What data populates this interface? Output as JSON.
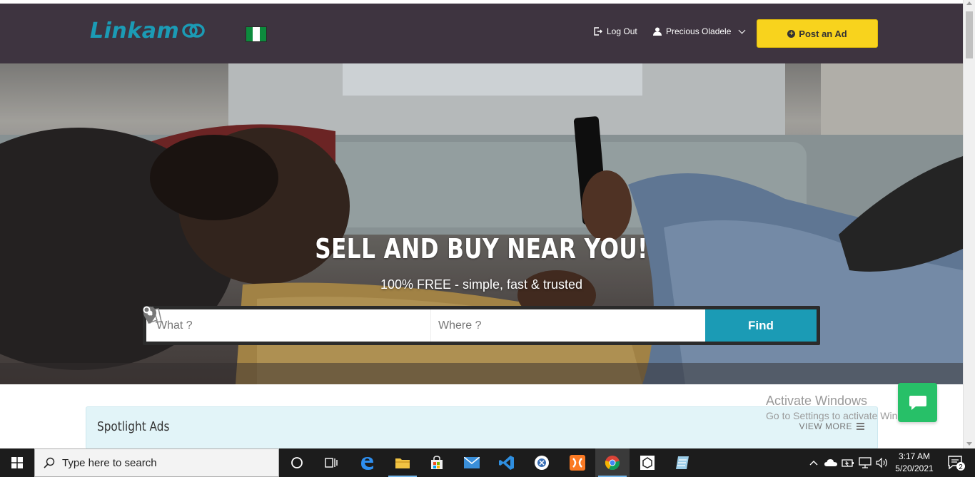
{
  "header": {
    "logo_text": "Linkam",
    "logout_label": "Log Out",
    "user_name": "Precious Oladele",
    "post_ad_label": "Post an Ad",
    "brand_color": "#1b9bb5",
    "accent_color": "#f8d31d"
  },
  "hero": {
    "title": "SELL AND BUY NEAR YOU!",
    "subtitle": "100% FREE - simple, fast & trusted",
    "search": {
      "what_placeholder": "What ?",
      "where_placeholder": "Where ?",
      "find_label": "Find"
    }
  },
  "spotlight": {
    "title": "Spotlight Ads",
    "view_more_label": "VIEW MORE"
  },
  "watermark": {
    "line1": "Activate Windows",
    "line2": "Go to Settings to activate Windows."
  },
  "taskbar": {
    "search_placeholder": "Type here to search",
    "time": "3:17 AM",
    "date": "5/20/2021",
    "notification_count": "2",
    "apps": [
      "cortana-icon",
      "task-view-icon",
      "edge-icon",
      "file-explorer-icon",
      "store-icon",
      "mail-icon",
      "vscode-icon",
      "sublime-icon",
      "xampp-icon",
      "chrome-icon",
      "unity-icon",
      "notepad-icon"
    ]
  }
}
